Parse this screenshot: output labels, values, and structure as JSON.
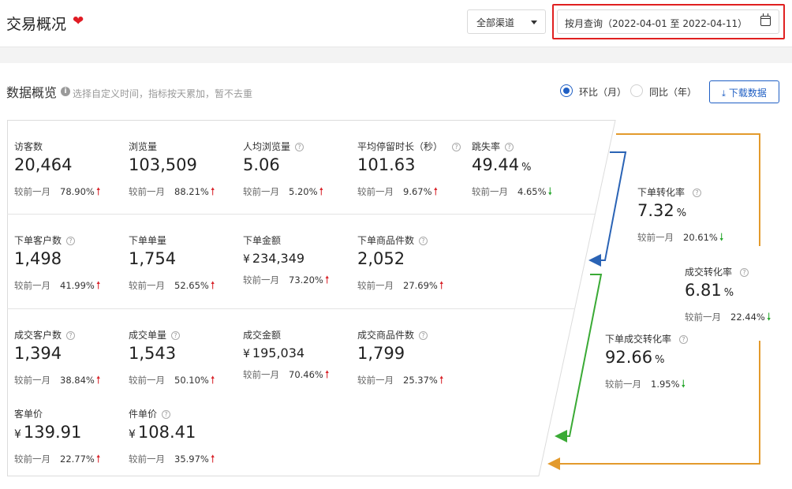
{
  "header": {
    "title": "交易概况",
    "channel_select": "全部渠道",
    "date_range": "按月查询（2022-04-01 至 2022-04-11）"
  },
  "overview": {
    "title": "数据概览",
    "hint": "选择自定义时间，指标按天累加，暂不去重",
    "radio_mom": "环比（月）",
    "radio_yoy": "同比（年）",
    "download_label": "下载数据",
    "compare_label": "较前一月"
  },
  "metrics": {
    "visitors": {
      "label": "访客数",
      "value": "20,464",
      "change": "78.90%",
      "trend": "up"
    },
    "pageviews": {
      "label": "浏览量",
      "value": "103,509",
      "change": "88.21%",
      "trend": "up"
    },
    "pv_per_user": {
      "label": "人均浏览量",
      "value": "5.06",
      "change": "5.20%",
      "trend": "up"
    },
    "avg_stay": {
      "label": "平均停留时长（秒）",
      "value": "101.63",
      "change": "9.67%",
      "trend": "up"
    },
    "bounce_rate": {
      "label": "跳失率",
      "value": "49.44",
      "unit": "%",
      "change": "4.65%",
      "trend": "down"
    },
    "order_customers": {
      "label": "下单客户数",
      "value": "1,498",
      "change": "41.99%",
      "trend": "up"
    },
    "order_count": {
      "label": "下单单量",
      "value": "1,754",
      "change": "52.65%",
      "trend": "up"
    },
    "order_amount": {
      "label": "下单金额",
      "currency": "¥",
      "value": "234,349",
      "change": "73.20%",
      "trend": "up"
    },
    "order_items": {
      "label": "下单商品件数",
      "value": "2,052",
      "change": "27.69%",
      "trend": "up"
    },
    "deal_customers": {
      "label": "成交客户数",
      "value": "1,394",
      "change": "38.84%",
      "trend": "up"
    },
    "deal_count": {
      "label": "成交单量",
      "value": "1,543",
      "change": "50.10%",
      "trend": "up"
    },
    "deal_amount": {
      "label": "成交金额",
      "currency": "¥",
      "value": "195,034",
      "change": "70.46%",
      "trend": "up"
    },
    "deal_items": {
      "label": "成交商品件数",
      "value": "1,799",
      "change": "25.37%",
      "trend": "up"
    },
    "avg_order_value": {
      "label": "客单价",
      "currency": "¥",
      "value": "139.91",
      "change": "22.77%",
      "trend": "up"
    },
    "avg_item_price": {
      "label": "件单价",
      "currency": "¥",
      "value": "108.41",
      "change": "35.97%",
      "trend": "up"
    }
  },
  "conversions": {
    "order_rate": {
      "label": "下单转化率",
      "value": "7.32",
      "unit": "%",
      "change": "20.61%",
      "trend": "down"
    },
    "deal_rate": {
      "label": "成交转化率",
      "value": "6.81",
      "unit": "%",
      "change": "22.44%",
      "trend": "down"
    },
    "order_deal_rate": {
      "label": "下单成交转化率",
      "value": "92.66",
      "unit": "%",
      "change": "1.95%",
      "trend": "down"
    }
  },
  "colors": {
    "accent": "#1f5fc4",
    "highlight": "#e02020",
    "up": "#d9262c",
    "down": "#2aa830",
    "flow_blue": "#2a63b5",
    "flow_green": "#3aaa35",
    "flow_orange": "#e39a2c"
  }
}
